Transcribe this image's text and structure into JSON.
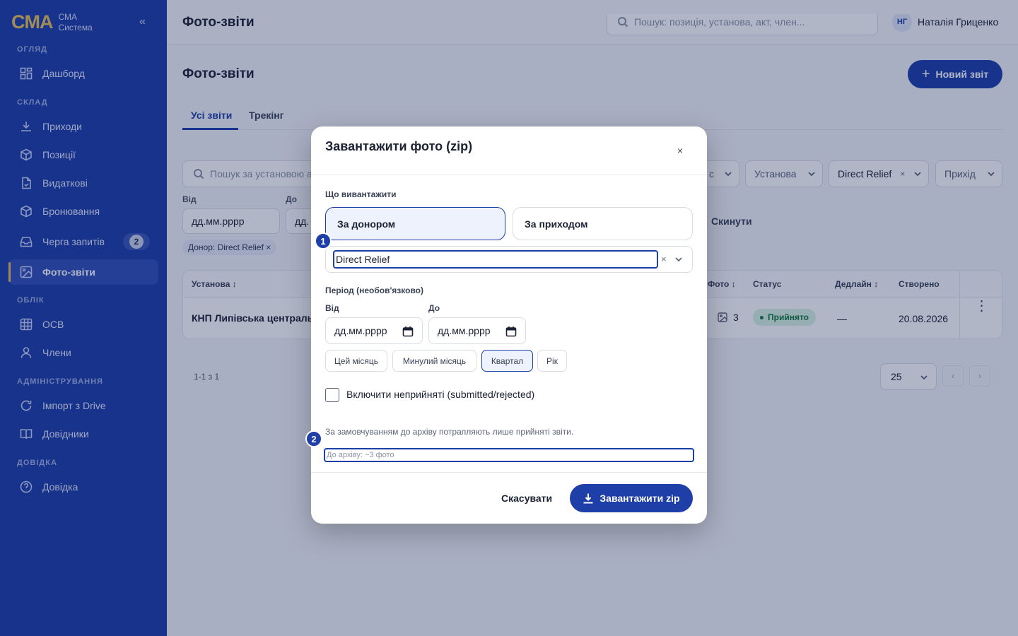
{
  "sidebar": {
    "logo": "CMA",
    "brand_line1": "СМА",
    "brand_line2": "Система",
    "collapse_glyph": "«",
    "sections": [
      "ОГЛЯД",
      "СКЛАД",
      "ОБЛІК",
      "АДМІНІСТРУВАННЯ",
      "ДОВІДКА"
    ],
    "items": [
      {
        "label": "Дашборд",
        "icon": "dashboard-icon"
      },
      {
        "label": "Приходи",
        "icon": "download-icon"
      },
      {
        "label": "Позиції",
        "icon": "box-icon"
      },
      {
        "label": "Видаткові",
        "icon": "document-icon"
      },
      {
        "label": "Бронювання",
        "icon": "box-icon"
      },
      {
        "label": "Черга запитів",
        "icon": "inbox-icon",
        "badge": "2"
      },
      {
        "label": "Фото-звіти",
        "icon": "image-icon",
        "active": true
      },
      {
        "label": "ОСВ",
        "icon": "grid-icon"
      },
      {
        "label": "Члени",
        "icon": "user-icon"
      },
      {
        "label": "Імпорт з Drive",
        "icon": "refresh-icon"
      },
      {
        "label": "Довідники",
        "icon": "book-icon"
      },
      {
        "label": "Довідка",
        "icon": "help-icon"
      }
    ]
  },
  "header": {
    "title": "Фото-звіти",
    "search_placeholder": "Пошук: позиція, установа, акт, член...",
    "avatar_initials": "НГ",
    "user_name": "Наталія Гриценко"
  },
  "page": {
    "title": "Фото-звіти",
    "new_button": "Новий звіт",
    "tabs": [
      "Усі звіти",
      "Трекінг"
    ]
  },
  "filters": {
    "search_placeholder": "Пошук за установою а",
    "selects": [
      "с",
      "Установа",
      "Direct Relief",
      "Прихід"
    ],
    "from_label": "Від",
    "to_label": "До",
    "date_placeholder": "дд.мм.рррр",
    "date_placeholder_short": "дд.",
    "reset": "Скинути",
    "chip": "Донор: Direct Relief ×"
  },
  "table": {
    "headers": [
      "Установа ↕",
      "Фото ↕",
      "Статус",
      "Дедлайн ↕",
      "Створено"
    ],
    "row": {
      "institution": "КНП Липівська центральна",
      "photos": "3",
      "status": "Прийнято",
      "deadline": "—",
      "created": "20.08.2026",
      "menu": "⋮"
    },
    "status_color": "#137a3a"
  },
  "pagination": {
    "range": "1-1 з 1",
    "per_page": "25",
    "prev": "‹",
    "next": "›"
  },
  "modal": {
    "title": "Завантажити фото (zip)",
    "close": "×",
    "what_label": "Що вивантажити",
    "option_donor": "За донором",
    "option_arrival": "За приходом",
    "donor_value": "Direct Relief",
    "clear": "×",
    "period_label": "Період (необов'язково)",
    "from_label": "Від",
    "to_label": "До",
    "date_placeholder": "дд.мм.рррр",
    "quick": [
      "Цей місяць",
      "Минулий місяць",
      "Квартал",
      "Рік"
    ],
    "include_label": "Включити неприйняті (submitted/rejected)",
    "note": "За замовчуванням до архіву потрапляють лише прийняті звіти.",
    "archive_count": "До архіву: ~3 фото",
    "cancel": "Скасувати",
    "download": "Завантажити zip"
  },
  "markers": [
    "1",
    "2"
  ],
  "colors": {
    "accent": "#1e3ea8",
    "logo": "#e8c15c",
    "success_bg": "#d7f3df"
  }
}
